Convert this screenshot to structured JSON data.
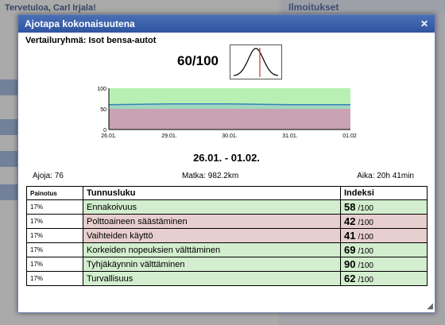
{
  "background": {
    "user_name": "Tervetuloa, Carl Irjala!",
    "side_header": "Ilmoitukset"
  },
  "dialog": {
    "title": "Ajotapa kokonaisuutena",
    "close_label": "✕",
    "group_label": "Vertailuryhmä: Isot bensa-autot",
    "score": "60/100",
    "date_range": "26.01. - 01.02.",
    "stats": {
      "trips": "Ajoja: 76",
      "distance": "Matka: 982.2km",
      "time": "Aika: 20h 41min"
    },
    "table": {
      "headers": [
        "Painotus",
        "Tunnusluku",
        "Indeksi"
      ],
      "unit": "/100",
      "rows": [
        {
          "weight": "17%",
          "name": "Ennakoivuus",
          "index": "58",
          "status": "green"
        },
        {
          "weight": "17%",
          "name": "Polttoaineen säästäminen",
          "index": "42",
          "status": "red"
        },
        {
          "weight": "17%",
          "name": "Vaihteiden käyttö",
          "index": "41",
          "status": "red"
        },
        {
          "weight": "17%",
          "name": "Korkeiden nopeuksien välttäminen",
          "index": "69",
          "status": "green"
        },
        {
          "weight": "17%",
          "name": "Tyhjäkäynnin välttäminen",
          "index": "90",
          "status": "green"
        },
        {
          "weight": "17%",
          "name": "Turvallisuus",
          "index": "62",
          "status": "green"
        }
      ]
    }
  },
  "chart_data": {
    "type": "area",
    "x": [
      "26.01.",
      "29.01.",
      "30.01.",
      "31.01.",
      "01.02."
    ],
    "y_ticks": [
      0,
      50,
      100
    ],
    "ylim": [
      0,
      100
    ],
    "zones": [
      {
        "from": 0,
        "to": 50,
        "color": "#f3a9a9"
      },
      {
        "from": 50,
        "to": 100,
        "color": "#b8f0b4"
      }
    ],
    "series": [
      {
        "values": [
          60,
          62,
          62,
          60,
          60
        ],
        "color": "#3a7fc0"
      }
    ]
  }
}
